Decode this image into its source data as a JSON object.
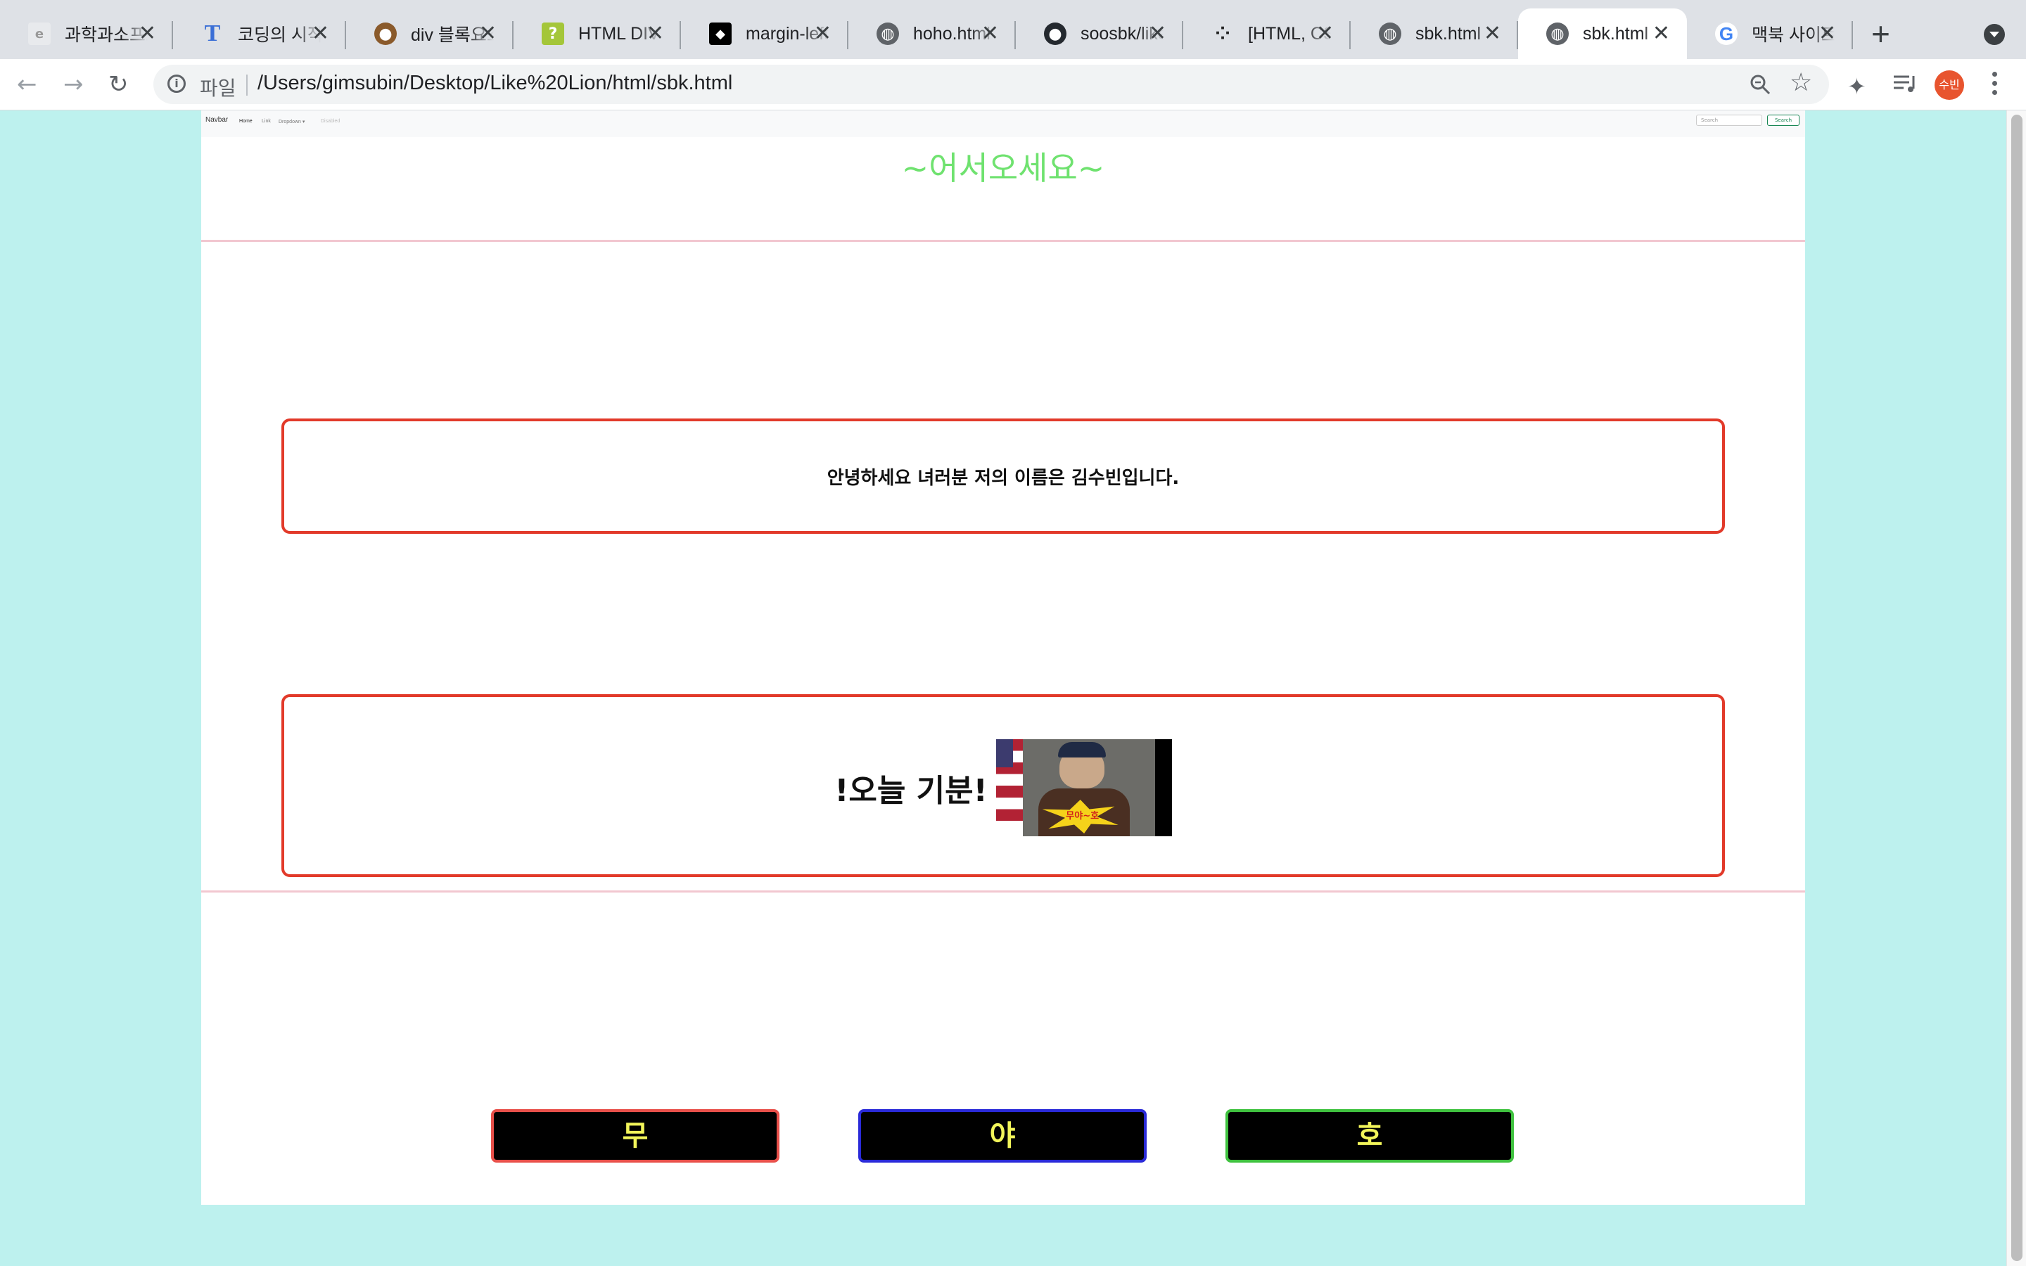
{
  "browser": {
    "tabs": [
      {
        "title": "과학과소프트",
        "favicon": "doc-icon",
        "active": false
      },
      {
        "title": "코딩의 시작",
        "favicon": "letter-t-icon",
        "active": false
      },
      {
        "title": "div 블록요소",
        "favicon": "bear-icon",
        "active": false
      },
      {
        "title": "HTML DIV",
        "favicon": "question-icon",
        "active": false
      },
      {
        "title": "margin-left",
        "favicon": "codepen-icon",
        "active": false
      },
      {
        "title": "hoho.html",
        "favicon": "globe-icon",
        "active": false
      },
      {
        "title": "soosbk/like",
        "favicon": "github-icon",
        "active": false
      },
      {
        "title": "[HTML, CSS]",
        "favicon": "dots-icon",
        "active": false
      },
      {
        "title": "sbk.html",
        "favicon": "globe-icon",
        "active": false
      },
      {
        "title": "sbk.html",
        "favicon": "globe-icon",
        "active": true
      },
      {
        "title": "맥북 사이트",
        "favicon": "google-icon",
        "active": false
      }
    ],
    "new_tab_glyph": "+",
    "scheme_label": "파일",
    "url": "/Users/gimsubin/Desktop/Like%20Lion/html/sbk.html",
    "profile_initials": "수빈"
  },
  "page": {
    "navbar": {
      "brand": "Navbar",
      "links": [
        "Home",
        "Link",
        "Dropdown ▾",
        "Disabled"
      ],
      "search_placeholder": "Search",
      "search_button": "Search"
    },
    "welcome": "~어서오세요~",
    "greeting": "안녕하세요 녀러분 저의 이름은 김수빈입니다.",
    "mood_label": "!오늘 기분!",
    "mood_image_caption": "무야~호",
    "buttons": [
      {
        "label": "무",
        "border_color": "#e8504a"
      },
      {
        "label": "야",
        "border_color": "#2a2ad8"
      },
      {
        "label": "호",
        "border_color": "#3fc23f"
      }
    ]
  },
  "colors": {
    "page_background": "#bdf1ee",
    "welcome_text": "#6fe26f",
    "box_border": "#e23a2a",
    "button_text": "#f2f55a",
    "rule": "#f2c7d0"
  }
}
